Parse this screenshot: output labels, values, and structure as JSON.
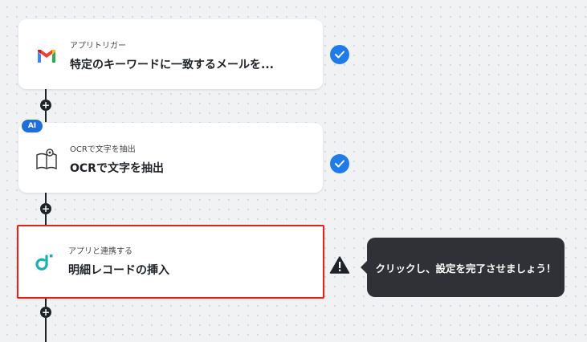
{
  "flow": {
    "steps": [
      {
        "subtitle": "アプリトリガー",
        "title": "特定のキーワードに一致するメールを...",
        "icon": "gmail-icon",
        "status": "complete"
      },
      {
        "badge": "AI",
        "subtitle": "OCRで文字を抽出",
        "title": "OCRで文字を抽出",
        "icon": "ocr-book-icon",
        "status": "complete"
      },
      {
        "subtitle": "アプリと連携する",
        "title": "明細レコードの挿入",
        "icon": "app-logo-icon",
        "status": "warning"
      }
    ],
    "tooltip": "クリックし、設定を完了させましょう！"
  },
  "colors": {
    "accent": "#1e7be8",
    "selected_border": "#e0231b",
    "tooltip_bg": "#2f3136"
  }
}
